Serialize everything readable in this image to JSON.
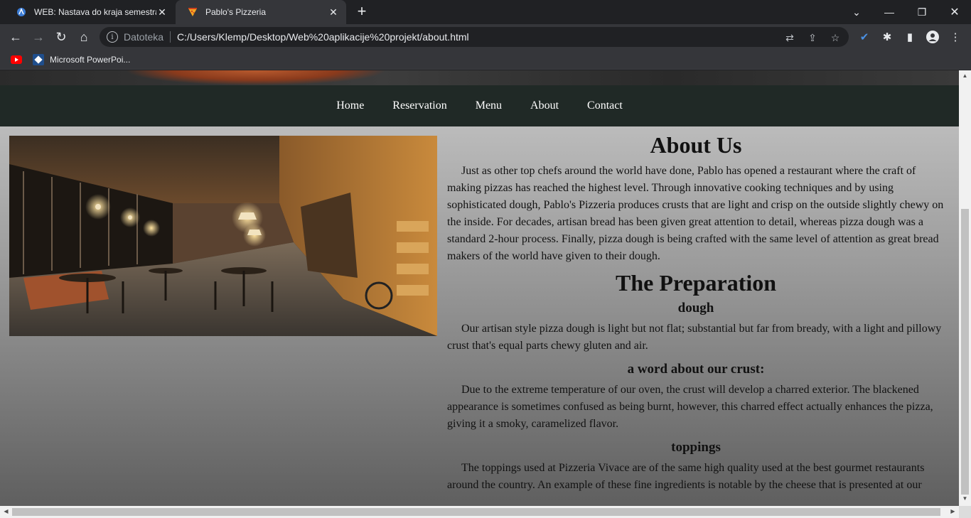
{
  "browser": {
    "tabs": [
      {
        "title": "WEB: Nastava do kraja semestra,",
        "active": false,
        "icon": "moodle-icon"
      },
      {
        "title": "Pablo's Pizzeria",
        "active": true,
        "icon": "pizza-icon"
      }
    ],
    "address": {
      "scheme_label": "Datoteka",
      "url": "C:/Users/Klemp/Desktop/Web%20aplikacije%20projekt/about.html"
    },
    "bookmarks": [
      {
        "label": "",
        "icon": "youtube-icon"
      },
      {
        "label": "Microsoft PowerPoi...",
        "icon": "powerpoint-icon"
      }
    ]
  },
  "site": {
    "nav": [
      "Home",
      "Reservation",
      "Menu",
      "About",
      "Contact"
    ],
    "about_title": "About Us",
    "about_text": "Just as other top chefs around the world have done, Pablo has opened a restaurant where the craft of making pizzas has reached the highest level. Through innovative cooking techniques and by using sophisticated dough, Pablo's Pizzeria produces crusts that are light and crisp on the outside slightly chewy on the inside. For decades, artisan bread has been given great attention to detail, whereas pizza dough was a standard 2-hour process. Finally, pizza dough is being crafted with the same level of attention as great bread makers of the world have given to their dough.",
    "prep_title": "The Preparation",
    "sections": [
      {
        "heading": "dough",
        "text": "Our artisan style pizza dough is light but not flat; substantial but far from bready, with a light and pillowy crust that's equal parts chewy gluten and air."
      },
      {
        "heading": "a word about our crust:",
        "text": "Due to the extreme temperature of our oven, the crust will develop a charred exterior. The blackened appearance is sometimes confused as being burnt, however, this charred effect actually enhances the pizza, giving it a smoky, caramelized flavor."
      },
      {
        "heading": "toppings",
        "text": "The toppings used at Pizzeria Vivace are of the same high quality used at the best gourmet restaurants around the country. An example of these fine ingredients is notable by the cheese that is presented at our"
      }
    ]
  }
}
